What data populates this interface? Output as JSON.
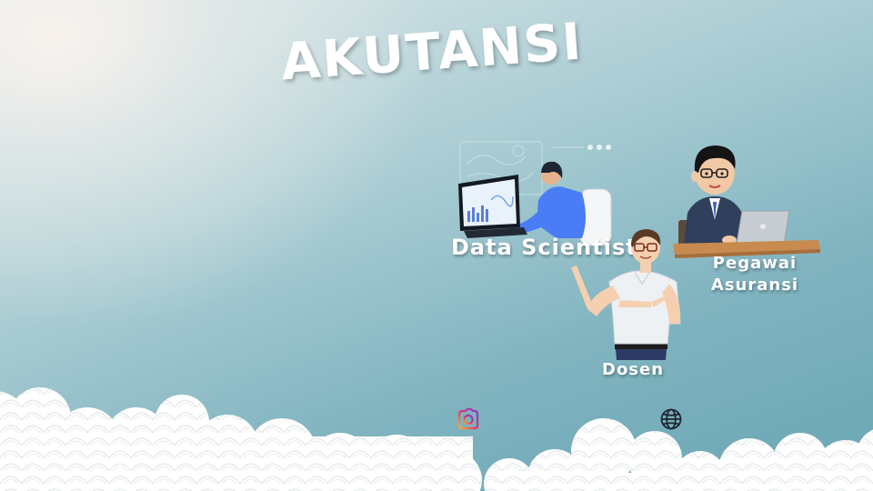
{
  "slide": {
    "title": "AKUTANSI",
    "careers": [
      {
        "label": "Data Scientist",
        "figure": "data-scientist-illustration"
      },
      {
        "label_line1": "Pegawai",
        "label_line2": "Asuransi",
        "figure": "insurance-employee-illustration"
      },
      {
        "label": "Dosen",
        "figure": "lecturer-illustration"
      }
    ],
    "icons": [
      "instagram-icon",
      "globe-icon"
    ]
  },
  "colors": {
    "background_light": "#f6efe9",
    "background_teal": "#6aa6b4",
    "cloud": "#ffffff",
    "text": "#ffffff"
  }
}
